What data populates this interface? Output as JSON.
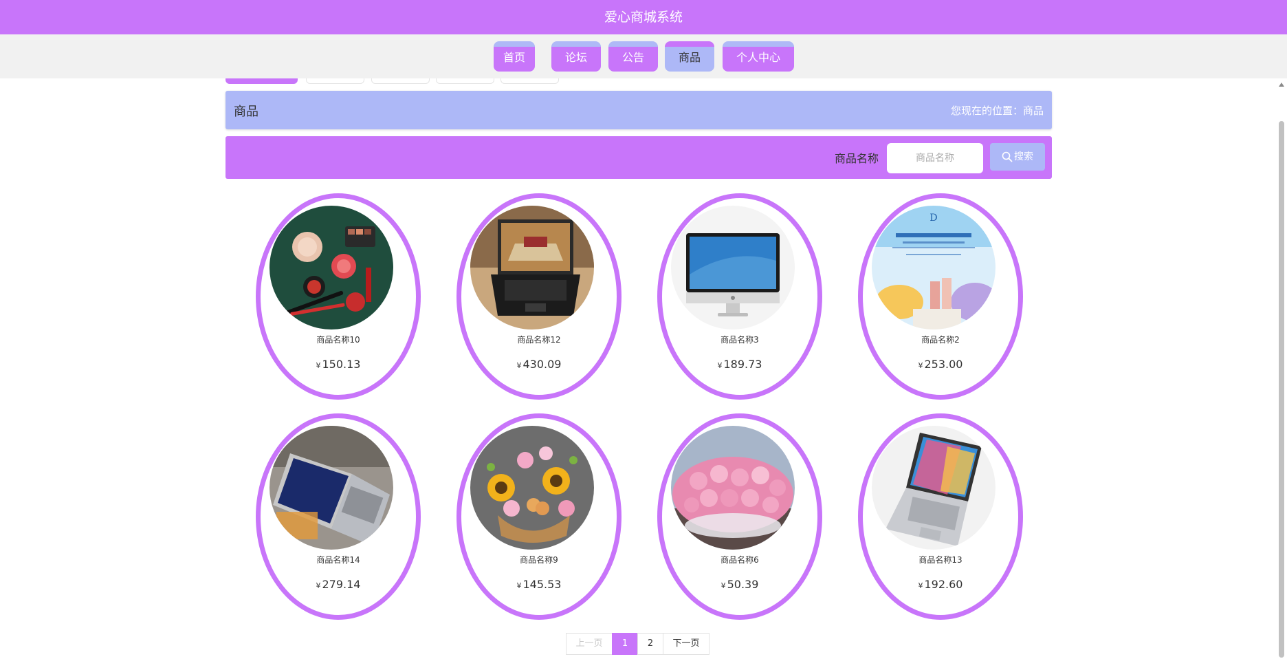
{
  "app_title": "爱心商城系统",
  "nav": {
    "items": [
      {
        "label": "首页",
        "active": false
      },
      {
        "label": "论坛",
        "active": false
      },
      {
        "label": "公告",
        "active": false
      },
      {
        "label": "商品",
        "active": true
      },
      {
        "label": "个人中心",
        "active": false
      }
    ]
  },
  "breadcrumb": {
    "title": "商品",
    "location": "您现在的位置：商品"
  },
  "search": {
    "label": "商品名称",
    "placeholder": "商品名称",
    "button_label": "搜索",
    "button_icon": "search-icon"
  },
  "products": [
    {
      "name": "商品名称10",
      "price": "150.13",
      "image": "cosmetics-photo"
    },
    {
      "name": "商品名称12",
      "price": "430.09",
      "image": "laptop-photo"
    },
    {
      "name": "商品名称3",
      "price": "189.73",
      "image": "imac-photo"
    },
    {
      "name": "商品名称2",
      "price": "253.00",
      "image": "skincare-poster"
    },
    {
      "name": "商品名称14",
      "price": "279.14",
      "image": "laptop-open-photo"
    },
    {
      "name": "商品名称9",
      "price": "145.53",
      "image": "sunflower-basket-photo"
    },
    {
      "name": "商品名称6",
      "price": "50.39",
      "image": "pink-roses-photo"
    },
    {
      "name": "商品名称13",
      "price": "192.60",
      "image": "colorful-laptop-photo"
    }
  ],
  "currency_symbol": "¥",
  "pagination": {
    "prev_label": "上一页",
    "pages": [
      "1",
      "2"
    ],
    "current": "1",
    "next_label": "下一页"
  },
  "colors": {
    "primary": "#c875fa",
    "secondary": "#adb8f7"
  }
}
